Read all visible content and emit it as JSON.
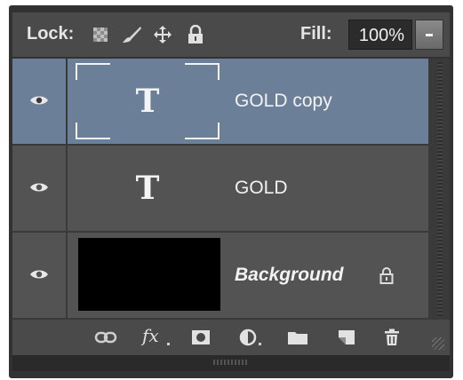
{
  "lock_bar": {
    "label": "Lock:",
    "icons": [
      "transparency-lock-icon",
      "brush-lock-icon",
      "move-lock-icon",
      "padlock-icon"
    ],
    "fill_label": "Fill:",
    "fill_value": "100%"
  },
  "layers": [
    {
      "name": "GOLD copy",
      "type": "text",
      "thumb_glyph": "T",
      "selected": true,
      "visible": true
    },
    {
      "name": "GOLD",
      "type": "text",
      "thumb_glyph": "T",
      "selected": false,
      "visible": true
    },
    {
      "name": "Background",
      "type": "image",
      "selected": false,
      "visible": true,
      "locked": true
    }
  ],
  "toolbar": {
    "icons": [
      "link-layers-icon",
      "fx-layer-style-icon",
      "layer-mask-icon",
      "adjustment-layer-icon",
      "new-group-icon",
      "new-layer-icon",
      "trash-icon"
    ],
    "fx_label": "fx"
  },
  "colors": {
    "selected_row": "#6c7f99",
    "row": "#535353",
    "panel": "#323232"
  }
}
